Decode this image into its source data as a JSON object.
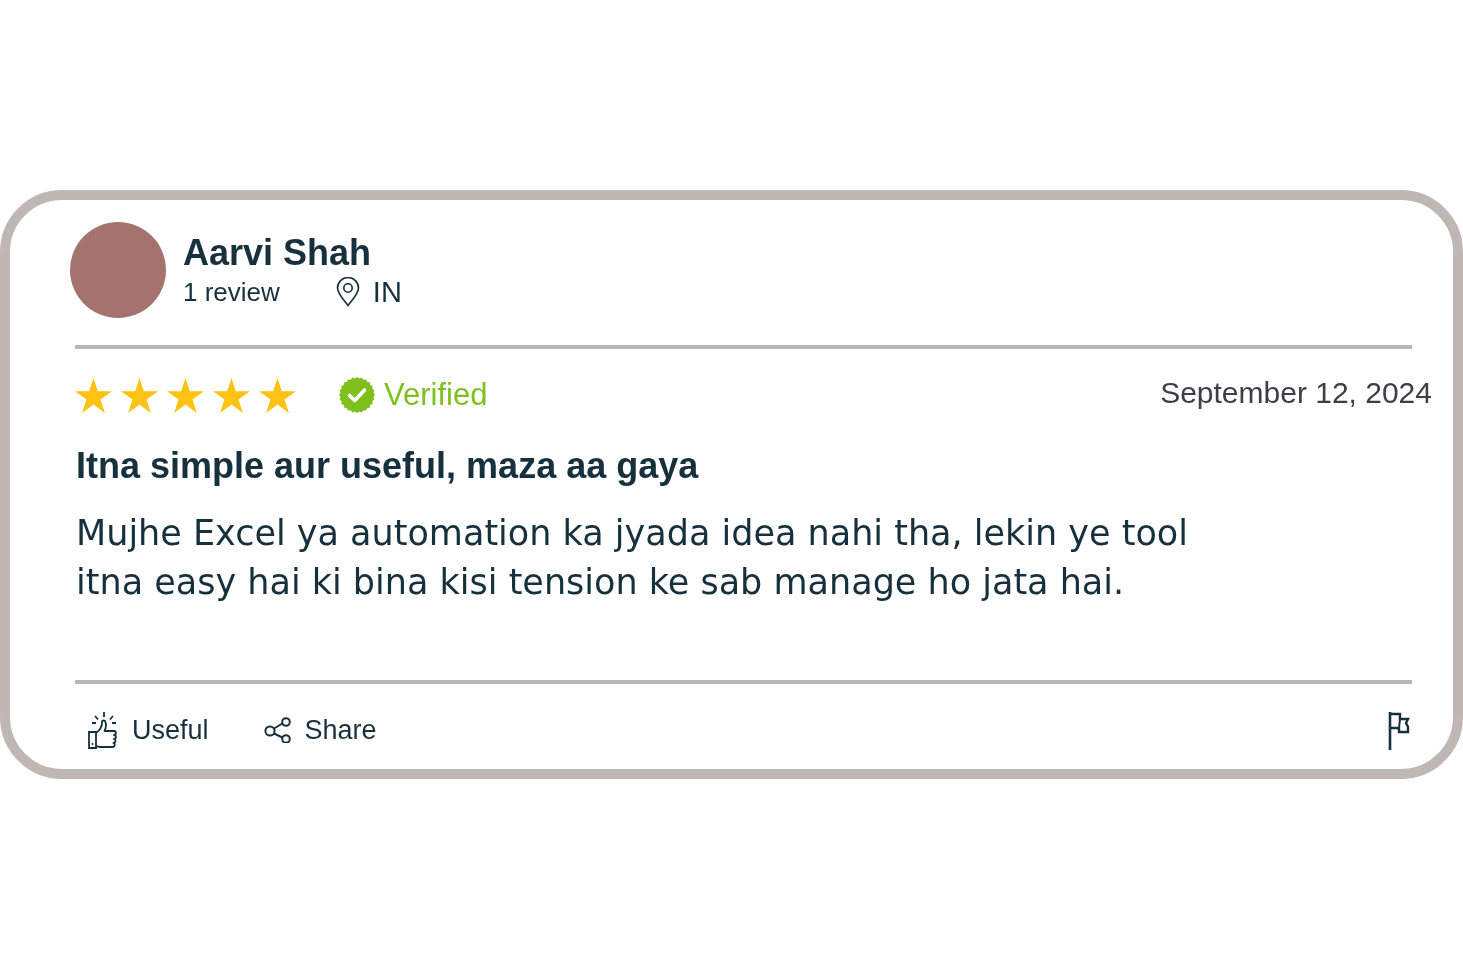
{
  "review": {
    "reviewer": {
      "name": "Aarvi Shah",
      "review_count": "1 review",
      "location": "IN"
    },
    "stars": 5,
    "verified": true,
    "verified_label": "Verified",
    "date": "September 12, 2024",
    "title": "Itna simple aur useful, maza aa gaya",
    "body": "Mujhe Excel ya automation ka jyada idea nahi tha, lekin ye tool itna easy hai ki bina kisi tension ke sab manage ho jata hai.",
    "actions": [
      {
        "kind": "useful",
        "label": "Useful"
      },
      {
        "kind": "share",
        "label": "Share"
      }
    ]
  }
}
